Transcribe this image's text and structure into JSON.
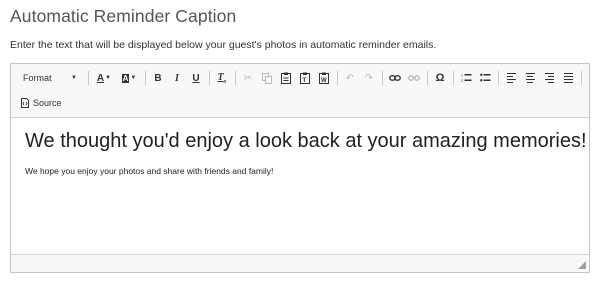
{
  "page": {
    "title": "Automatic Reminder Caption",
    "description": "Enter the text that will be displayed below your guest's photos in automatic reminder emails."
  },
  "toolbar": {
    "format_label": "Format",
    "source_label": "Source",
    "icons": [
      "text-color",
      "background-color",
      "bold",
      "italic",
      "underline",
      "remove-format",
      "cut",
      "copy",
      "paste",
      "paste-as-text",
      "paste-from-word",
      "undo",
      "redo",
      "link",
      "unlink",
      "special-character",
      "numbered-list",
      "bulleted-list",
      "align-left",
      "align-center",
      "align-right",
      "justify"
    ]
  },
  "editor": {
    "heading": "We thought you'd enjoy a look back at your amazing memories!",
    "body": "We hope you enjoy your photos and share with friends and family!"
  },
  "colors": {
    "border": "#c4c4c4",
    "toolbar_bg": "#f8f8f8",
    "disabled_icon": "#b8b8b8"
  }
}
